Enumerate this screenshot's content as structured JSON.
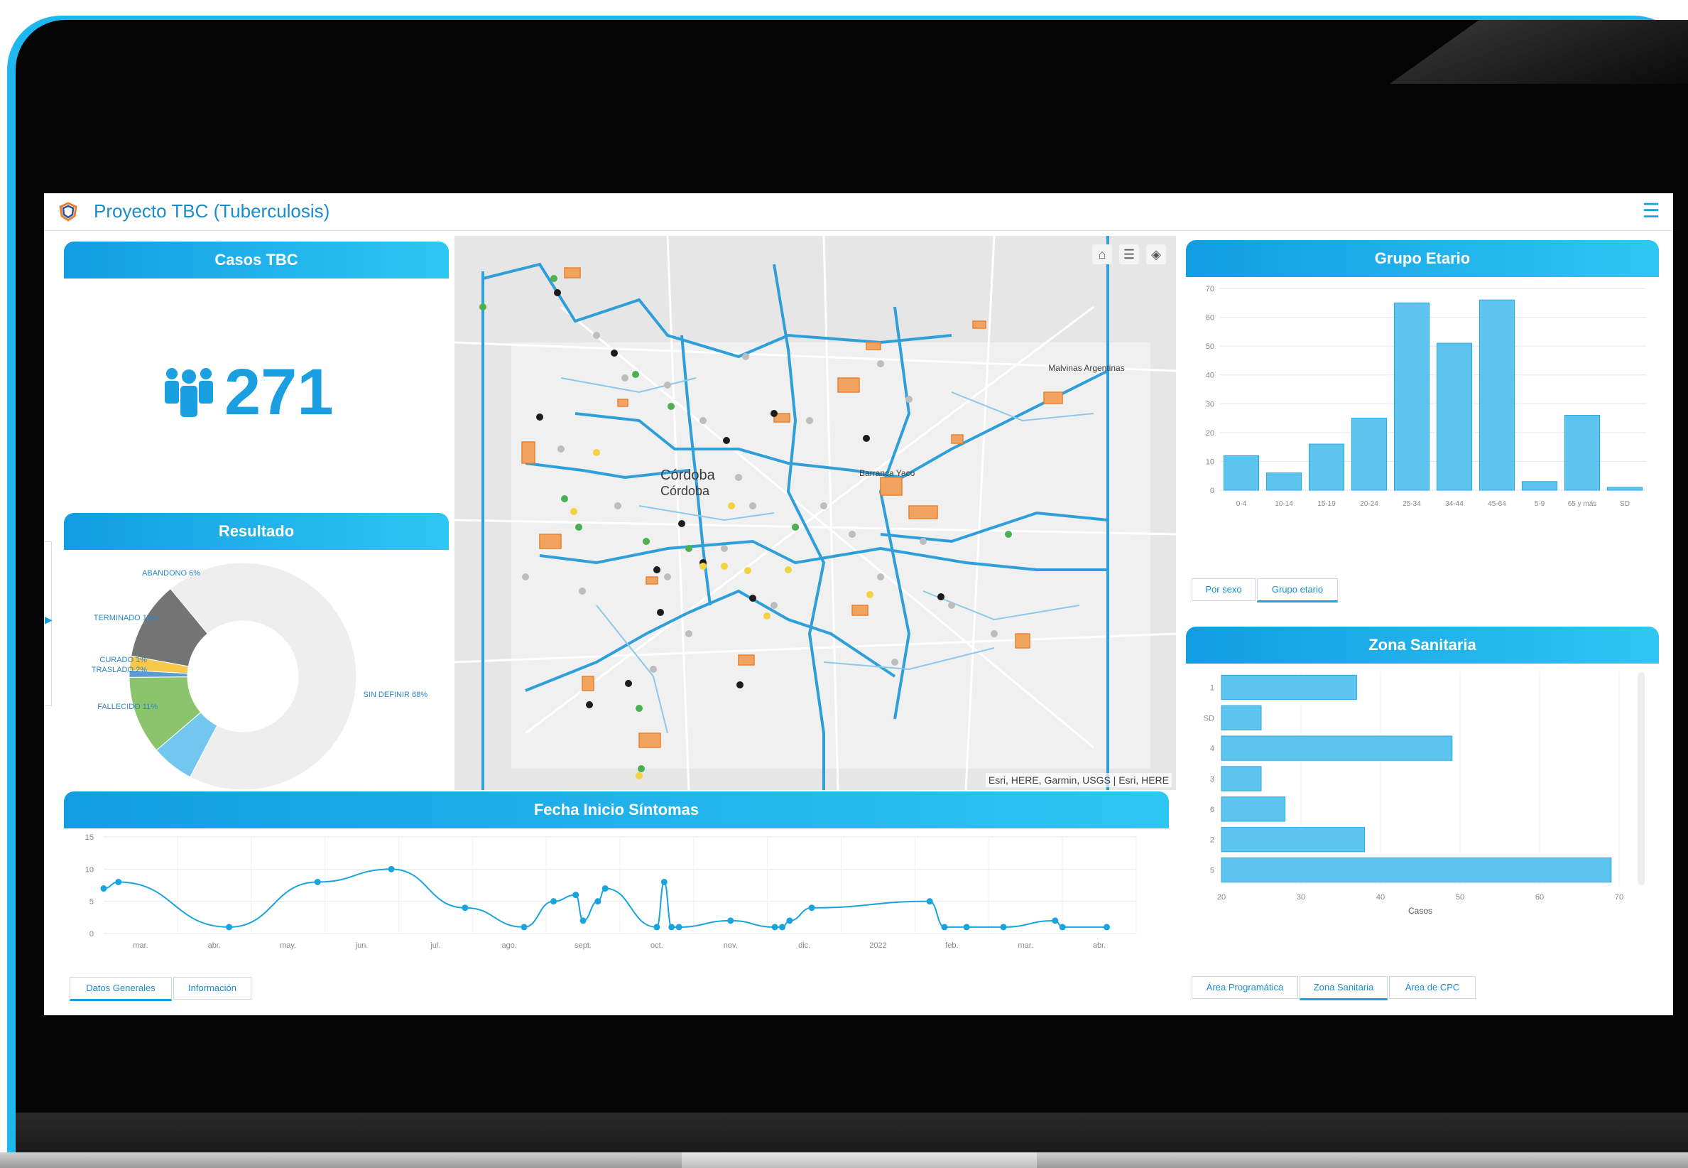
{
  "app": {
    "title": "Proyecto TBC (Tuberculosis)"
  },
  "colors": {
    "accent": "#1a9fe0",
    "bar": "#5cc4ee",
    "line": "#1aa4de"
  },
  "kpi": {
    "header": "Casos TBC",
    "value": "271",
    "icon": "people-icon"
  },
  "resultado": {
    "header": "Resultado",
    "labels": {
      "abandono": "ABANDONO 6%",
      "terminado": "TERMINADO 11%",
      "curado": "CURADO 1%",
      "traslado": "TRASLADO 2%",
      "fallecido": "FALLECIDO 11%",
      "sin_definir": "SIN DEFINIR 68%"
    }
  },
  "map": {
    "labels": [
      "Córdoba",
      "Córdoba",
      "Barranca Yaco",
      "Malvinas Argentinas"
    ],
    "attribution": "Esri, HERE, Garmin, USGS | Esri, HERE",
    "tools": [
      "home-icon",
      "list-icon",
      "layers-icon"
    ]
  },
  "grupo_etario": {
    "header": "Grupo Etario",
    "tabs": [
      "Por sexo",
      "Grupo etario"
    ],
    "active_tab": 1
  },
  "zona_sanitaria": {
    "header": "Zona Sanitaria",
    "tabs": [
      "Área Programática",
      "Zona Sanitaria",
      "Área de CPC"
    ],
    "active_tab": 1
  },
  "fecha": {
    "header": "Fecha Inicio Síntomas",
    "tabs": [
      "Datos Generales",
      "Información"
    ],
    "active_tab": 0
  },
  "chart_data": [
    {
      "type": "pie",
      "title": "Resultado",
      "donut": true,
      "categories": [
        "SIN DEFINIR",
        "ABANDONO",
        "TERMINADO",
        "CURADO",
        "TRASLADO",
        "FALLECIDO"
      ],
      "values": [
        68,
        6,
        11,
        1,
        2,
        11
      ],
      "colors": [
        "#eeeeee",
        "#73c7ee",
        "#8cc46e",
        "#5b9bd5",
        "#f6c84c",
        "#747474"
      ]
    },
    {
      "type": "bar",
      "title": "Grupo Etario",
      "categories": [
        "0-4",
        "10-14",
        "15-19",
        "20-24",
        "25-34",
        "34-44",
        "45-64",
        "5-9",
        "65 y más",
        "SD"
      ],
      "values": [
        12,
        6,
        16,
        25,
        65,
        51,
        66,
        3,
        26,
        1
      ],
      "ylim": [
        0,
        70
      ],
      "yticks": [
        0,
        10,
        20,
        30,
        40,
        50,
        60,
        70
      ]
    },
    {
      "type": "bar",
      "orientation": "horizontal",
      "title": "Zona Sanitaria",
      "categories": [
        "1",
        "SD",
        "4",
        "3",
        "6",
        "2",
        "5"
      ],
      "values": [
        37,
        25,
        49,
        25,
        28,
        38,
        69
      ],
      "xlabel": "Casos",
      "xlim": [
        20,
        70
      ],
      "xticks": [
        20,
        30,
        40,
        50,
        60,
        70
      ]
    },
    {
      "type": "line",
      "title": "Fecha Inicio Síntomas",
      "ylim": [
        0,
        15
      ],
      "yticks": [
        0,
        5,
        10,
        15
      ],
      "tick_labels": [
        "mar.",
        "abr.",
        "may.",
        "jun.",
        "jul.",
        "ago.",
        "sept.",
        "oct.",
        "nov.",
        "dic.",
        "2022",
        "feb.",
        "mar.",
        "abr."
      ],
      "x": [
        0,
        0.2,
        1.7,
        2.9,
        3.9,
        4.9,
        5.7,
        6.1,
        6.4,
        6.5,
        6.7,
        6.8,
        7.5,
        7.6,
        7.7,
        7.8,
        8.5,
        9.1,
        9.2,
        9.3,
        9.6,
        11.2,
        11.4,
        11.7,
        12.2,
        12.9,
        13.0,
        13.6
      ],
      "y": [
        7,
        8,
        1,
        8,
        10,
        4,
        1,
        5,
        6,
        2,
        5,
        7,
        1,
        8,
        1,
        1,
        2,
        1,
        1,
        2,
        4,
        5,
        1,
        1,
        1,
        2,
        1,
        1
      ]
    }
  ]
}
